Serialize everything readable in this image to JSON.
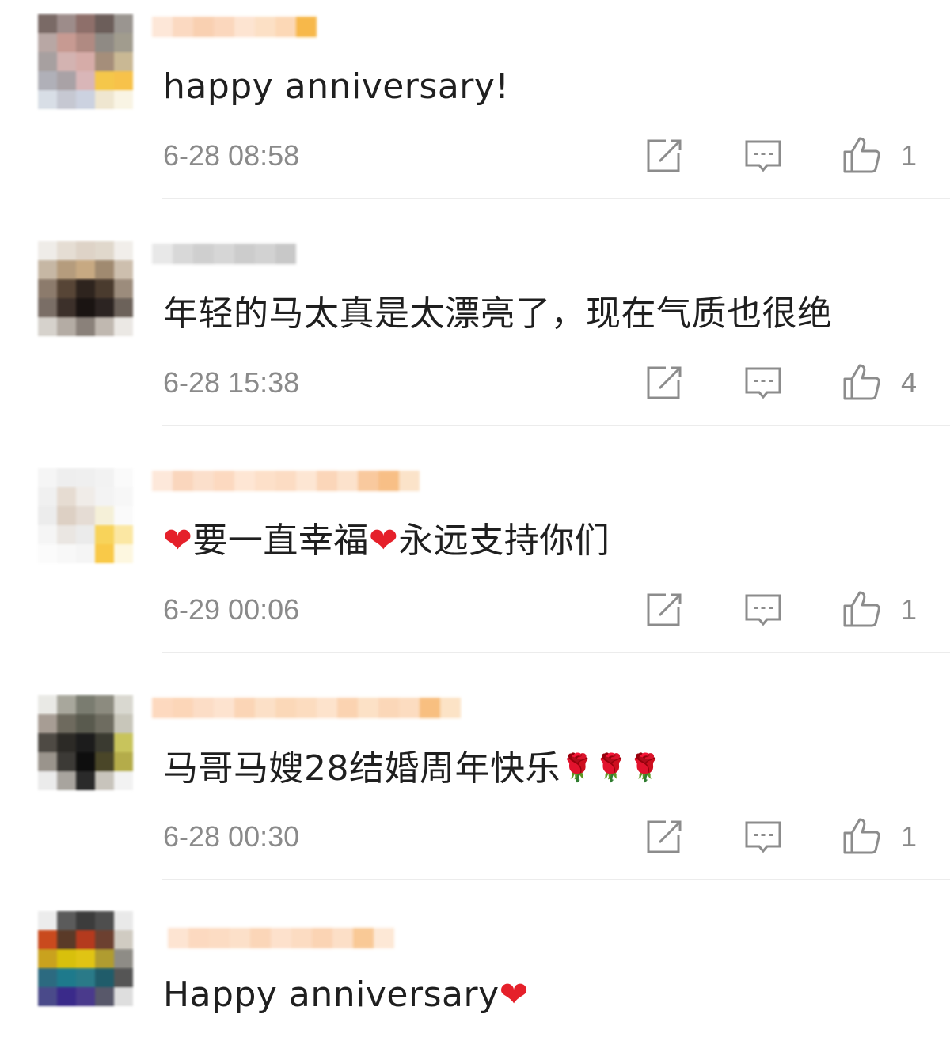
{
  "comments": [
    {
      "text": "happy anniversary!",
      "time": "6-28 08:58",
      "likes": "1",
      "avatar_colors": [
        "#7a6a66",
        "#9d8c8a",
        "#8e6f6a",
        "#6c5e5a",
        "#9a9590",
        "#b8a7a4",
        "#c79a92",
        "#b08a82",
        "#8f8a84",
        "#a19c8e",
        "#a7a0a0",
        "#d3b3b1",
        "#d6aca8",
        "#a58e7a",
        "#c9b894",
        "#b0b0b8",
        "#a9a2a6",
        "#d9b6b8",
        "#f5c74a",
        "#f7c24a",
        "#d8dee6",
        "#c6c8d2",
        "#ccd2e0",
        "#efe6d0",
        "#f9f4e4"
      ],
      "name_colors": [
        "#fde7d8",
        "#fbd9c1",
        "#f9d0b1",
        "#fbd7bd",
        "#fde4d1",
        "#fce0c5",
        "#fcd8b6",
        "#f7b84a"
      ]
    },
    {
      "text": "年轻的马太真是太漂亮了，现在气质也很绝",
      "time": "6-28 15:38",
      "likes": "4",
      "avatar_colors": [
        "#efece8",
        "#e5ddd3",
        "#ded3c7",
        "#e0d8cc",
        "#f1eeea",
        "#c6b7a4",
        "#b59c7d",
        "#c7a982",
        "#a08a70",
        "#cdbfae",
        "#8c7b6c",
        "#574536",
        "#2e241e",
        "#4a3b2e",
        "#9c8c7c",
        "#7a6e66",
        "#3c302a",
        "#1a1412",
        "#2c2422",
        "#6c625a",
        "#d6d2cc",
        "#b4aca4",
        "#8a817a",
        "#c0b8b0",
        "#ebe8e4"
      ],
      "name_colors": [
        "#e8e8e8",
        "#d8d8d8",
        "#cfcfcf",
        "#d6d6d6",
        "#cccccc",
        "#d2d2d2",
        "#c8c8c8"
      ]
    },
    {
      "text_parts": [
        "❤",
        "要一直幸福",
        "❤",
        "永远支持你们"
      ],
      "time": "6-29 00:06",
      "likes": "1",
      "avatar_colors": [
        "#f5f5f5",
        "#eeeeee",
        "#efefef",
        "#f2f2f2",
        "#fafafa",
        "#f0f0f0",
        "#e6dcd2",
        "#f0ece8",
        "#f3f3f3",
        "#f7f7f7",
        "#ececec",
        "#ddd0c4",
        "#e5dcd4",
        "#f5f0d8",
        "#fafafa",
        "#f5f5f5",
        "#eae6e2",
        "#ebebeb",
        "#f8d35a",
        "#fbe7a3",
        "#fbfbfb",
        "#f8f8f8",
        "#f5f5f5",
        "#f9c948",
        "#fdf7e0"
      ],
      "name_colors": [
        "#fde8da",
        "#fad6bd",
        "#fbdfcb",
        "#fcd9c0",
        "#fee6d4",
        "#fde0c9",
        "#fcdcc3",
        "#fde6d3",
        "#fbd6b9",
        "#fce2cc",
        "#f9c99e",
        "#f8bf86",
        "#fbe3c9"
      ]
    },
    {
      "text_parts": [
        "马哥马嫂28结婚周年快乐",
        "🌹",
        "🌹",
        "🌹"
      ],
      "time": "6-28 00:30",
      "likes": "1",
      "avatar_colors": [
        "#e9e9e5",
        "#a8a79c",
        "#7a7c70",
        "#8c8b7f",
        "#d9d8d0",
        "#a79d94",
        "#6e6a5e",
        "#595a4e",
        "#6e6c60",
        "#c8c6ba",
        "#4e4a44",
        "#2c2a26",
        "#1c1c1c",
        "#3a3a30",
        "#c8c45c",
        "#9a948c",
        "#3c3a36",
        "#0e0e0e",
        "#4a4628",
        "#b4ac4a",
        "#ebebeb",
        "#a8a49e",
        "#2a2a2a",
        "#c8c4bc",
        "#f2f2f2"
      ],
      "name_colors": [
        "#fdd9bf",
        "#fcd6b8",
        "#fcddc6",
        "#fde3cf",
        "#fbd5b6",
        "#fce0c7",
        "#fbd8b8",
        "#fcdcbf",
        "#fde3cc",
        "#fbd3b1",
        "#fce1c6",
        "#fbd7b8",
        "#fcdcc0",
        "#f8bf80",
        "#fce3c6"
      ]
    },
    {
      "text_parts": [
        "Happy anniversary",
        "❤"
      ],
      "avatar_colors": [
        "#ececec",
        "#5b5b5b",
        "#3c3c3c",
        "#4e4e4e",
        "#e9e9e9",
        "#c94a1e",
        "#5a3a28",
        "#b43a1e",
        "#6c4030",
        "#d0cbc2",
        "#c9a21e",
        "#d8c00c",
        "#e0c414",
        "#b09c30",
        "#8e8c86",
        "#2c6a80",
        "#1e7a8c",
        "#2a7a88",
        "#205c6a",
        "#555555",
        "#4a4a8a",
        "#3a2a8a",
        "#4a3a8c",
        "#58586a",
        "#dedede"
      ],
      "name_colors": [
        "#fde4d2",
        "#fcd9c0",
        "#fcdcc3",
        "#fce0c9",
        "#fbd6b8",
        "#fde1cc",
        "#fcdcc2",
        "#fbd4b4",
        "#fcdfc7",
        "#f9c996",
        "#fde8d6"
      ]
    }
  ],
  "icons": {
    "repost": "repost-icon",
    "reply": "comment-icon",
    "like": "thumbs-up-icon"
  },
  "colors": {
    "meta_gray": "#8a8a8a",
    "icon_gray": "#8c8c8c",
    "divider": "#ececec",
    "heart_red": "#e5202a"
  }
}
